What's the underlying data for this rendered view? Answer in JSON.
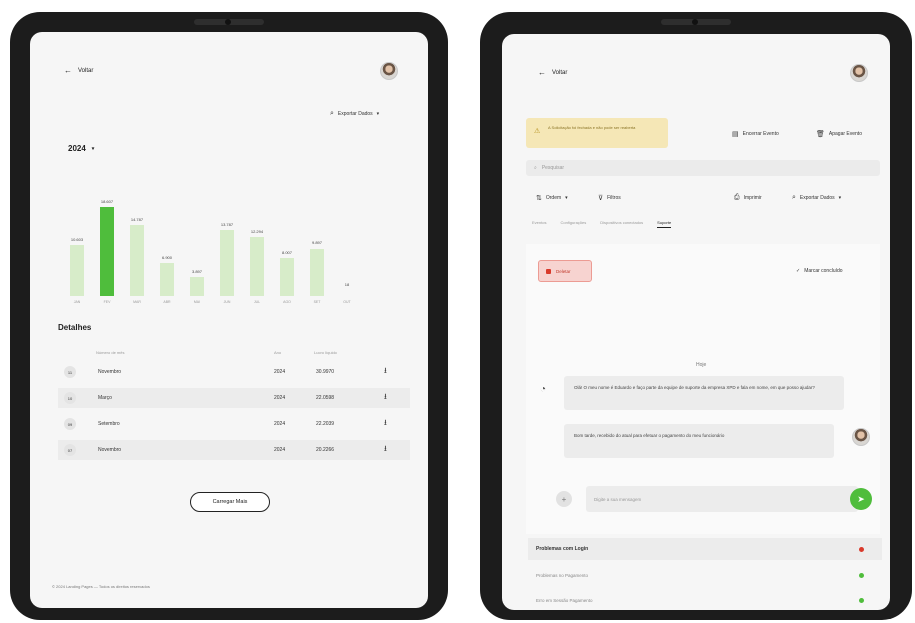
{
  "left": {
    "back_label": "Voltar",
    "export_label": "Exportar Dados",
    "year_label": "2024",
    "details_title": "Detalhes",
    "table_headers": [
      "",
      "Número de mês",
      "Ano",
      "Lucro líquido"
    ],
    "rows": [
      {
        "num": "11",
        "mes": "Novembro",
        "ano": "2024",
        "valor": "30.9970"
      },
      {
        "num": "10",
        "mes": "Março",
        "ano": "2024",
        "valor": "22.0598"
      },
      {
        "num": "09",
        "mes": "Setembro",
        "ano": "2024",
        "valor": "22.2039"
      },
      {
        "num": "07",
        "mes": "Novembro",
        "ano": "2024",
        "valor": "20.2266"
      }
    ],
    "load_more_label": "Carregar Mais",
    "footer": "© 2024 Landing Pages — Todos os direitos reservados"
  },
  "chart_data": {
    "type": "bar",
    "title": "",
    "categories": [
      "JAN",
      "FEV",
      "MAR",
      "ABR",
      "MAI",
      "JUN",
      "JUL",
      "AGO",
      "SET",
      "OUT"
    ],
    "values": [
      10603,
      18607,
      14787,
      6900,
      3897,
      13787,
      12294,
      8007,
      9897,
      1200
    ],
    "labels": [
      "10.603",
      "18.607",
      "14.787",
      "6.900",
      "3.897",
      "13.787",
      "12.294",
      "8.007",
      "9.897",
      "18"
    ],
    "highlight_index": 1,
    "ylim": [
      0,
      20000
    ],
    "colors": {
      "bar": "#d7ecc9",
      "highlight": "#4fbd3c"
    }
  },
  "right": {
    "back_label": "Voltar",
    "warning_text": "A Solicitação foi fechada e não pode ser reaberta",
    "mark_label": "Encerrar Evento",
    "delete_event_label": "Apagar Evento",
    "search_placeholder": "Pesquisar",
    "sort_label": "Ordem",
    "filter_label": "Filtros",
    "print_label": "Imprimir",
    "export_label": "Exportar Dados",
    "tabs": [
      "Eventos",
      "Configurações",
      "Dispositivos conectados",
      "Suporte"
    ],
    "delete_label": "Deletar",
    "mark_done_label": "Marcar concluído",
    "date_label": "Hoje",
    "msg_incoming": "Olá! O meu nome é Eduardo e faço parte da equipe de suporte da empresa XPD e fala em nome, em que posso ajudar?",
    "msg_outgoing": "Bom tarde, recebido do atual para efetuar o pagamento do meu funcionário",
    "input_placeholder": "Digite a sua mensagem",
    "issues": [
      {
        "label": "Problemas com Login",
        "status": "red"
      },
      {
        "label": "Problemas no Pagamento",
        "status": "green"
      },
      {
        "label": "Erro em Sessão Pagamento",
        "status": "green"
      }
    ]
  }
}
